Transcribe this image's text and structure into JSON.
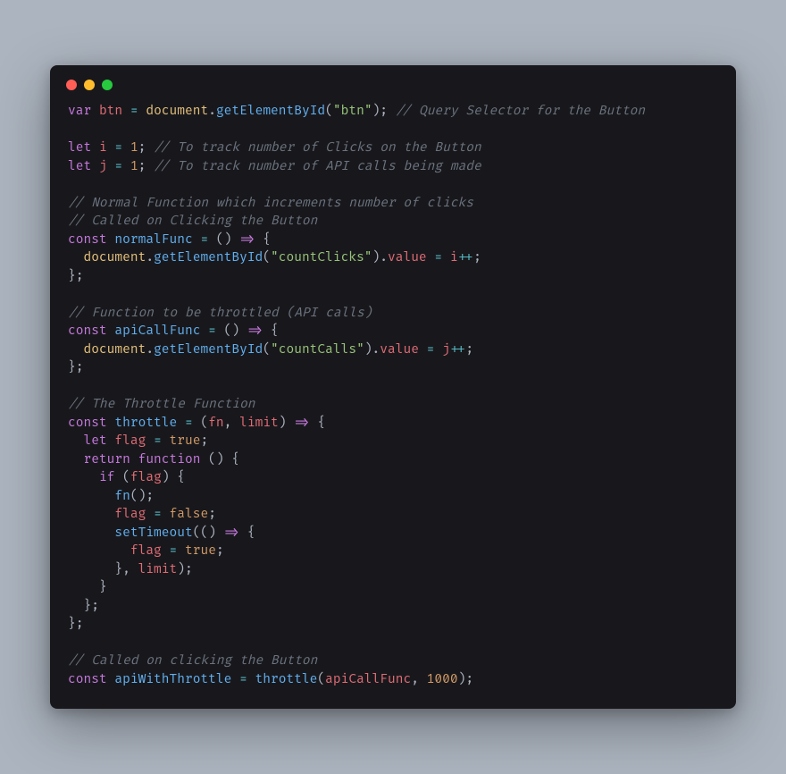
{
  "window": {
    "dots": [
      "close",
      "minimize",
      "zoom"
    ]
  },
  "code": {
    "lines": [
      [
        {
          "t": "var ",
          "c": "kw"
        },
        {
          "t": "btn",
          "c": "id"
        },
        {
          "t": " ",
          "c": "pn"
        },
        {
          "t": "=",
          "c": "op"
        },
        {
          "t": " ",
          "c": "pn"
        },
        {
          "t": "document",
          "c": "obj"
        },
        {
          "t": ".",
          "c": "pn"
        },
        {
          "t": "getElementById",
          "c": "fn"
        },
        {
          "t": "(",
          "c": "pn"
        },
        {
          "t": "\"btn\"",
          "c": "str"
        },
        {
          "t": "); ",
          "c": "pn"
        },
        {
          "t": "// Query Selector for the Button",
          "c": "cm"
        }
      ],
      [
        {
          "t": "",
          "c": "pn"
        }
      ],
      [
        {
          "t": "let ",
          "c": "kw"
        },
        {
          "t": "i",
          "c": "id"
        },
        {
          "t": " ",
          "c": "pn"
        },
        {
          "t": "=",
          "c": "op"
        },
        {
          "t": " ",
          "c": "pn"
        },
        {
          "t": "1",
          "c": "num"
        },
        {
          "t": "; ",
          "c": "pn"
        },
        {
          "t": "// To track number of Clicks on the Button",
          "c": "cm"
        }
      ],
      [
        {
          "t": "let ",
          "c": "kw"
        },
        {
          "t": "j",
          "c": "id"
        },
        {
          "t": " ",
          "c": "pn"
        },
        {
          "t": "=",
          "c": "op"
        },
        {
          "t": " ",
          "c": "pn"
        },
        {
          "t": "1",
          "c": "num"
        },
        {
          "t": "; ",
          "c": "pn"
        },
        {
          "t": "// To track number of API calls being made",
          "c": "cm"
        }
      ],
      [
        {
          "t": "",
          "c": "pn"
        }
      ],
      [
        {
          "t": "// Normal Function which increments number of clicks",
          "c": "cm"
        }
      ],
      [
        {
          "t": "// Called on Clicking the Button",
          "c": "cm"
        }
      ],
      [
        {
          "t": "const ",
          "c": "kw"
        },
        {
          "t": "normalFunc",
          "c": "fn"
        },
        {
          "t": " ",
          "c": "pn"
        },
        {
          "t": "=",
          "c": "op"
        },
        {
          "t": " () ",
          "c": "pn"
        },
        {
          "t": "=>",
          "c": "op2"
        },
        {
          "t": " {",
          "c": "pn"
        }
      ],
      [
        {
          "t": "  ",
          "c": "pn"
        },
        {
          "t": "document",
          "c": "obj"
        },
        {
          "t": ".",
          "c": "pn"
        },
        {
          "t": "getElementById",
          "c": "fn"
        },
        {
          "t": "(",
          "c": "pn"
        },
        {
          "t": "\"countClicks\"",
          "c": "str"
        },
        {
          "t": ").",
          "c": "pn"
        },
        {
          "t": "value",
          "c": "id"
        },
        {
          "t": " ",
          "c": "pn"
        },
        {
          "t": "=",
          "c": "op"
        },
        {
          "t": " ",
          "c": "pn"
        },
        {
          "t": "i",
          "c": "id"
        },
        {
          "t": "++",
          "c": "op"
        },
        {
          "t": ";",
          "c": "pn"
        }
      ],
      [
        {
          "t": "};",
          "c": "pn"
        }
      ],
      [
        {
          "t": "",
          "c": "pn"
        }
      ],
      [
        {
          "t": "// Function to be throttled (API calls)",
          "c": "cm"
        }
      ],
      [
        {
          "t": "const ",
          "c": "kw"
        },
        {
          "t": "apiCallFunc",
          "c": "fn"
        },
        {
          "t": " ",
          "c": "pn"
        },
        {
          "t": "=",
          "c": "op"
        },
        {
          "t": " () ",
          "c": "pn"
        },
        {
          "t": "=>",
          "c": "op2"
        },
        {
          "t": " {",
          "c": "pn"
        }
      ],
      [
        {
          "t": "  ",
          "c": "pn"
        },
        {
          "t": "document",
          "c": "obj"
        },
        {
          "t": ".",
          "c": "pn"
        },
        {
          "t": "getElementById",
          "c": "fn"
        },
        {
          "t": "(",
          "c": "pn"
        },
        {
          "t": "\"countCalls\"",
          "c": "str"
        },
        {
          "t": ").",
          "c": "pn"
        },
        {
          "t": "value",
          "c": "id"
        },
        {
          "t": " ",
          "c": "pn"
        },
        {
          "t": "=",
          "c": "op"
        },
        {
          "t": " ",
          "c": "pn"
        },
        {
          "t": "j",
          "c": "id"
        },
        {
          "t": "++",
          "c": "op"
        },
        {
          "t": ";",
          "c": "pn"
        }
      ],
      [
        {
          "t": "};",
          "c": "pn"
        }
      ],
      [
        {
          "t": "",
          "c": "pn"
        }
      ],
      [
        {
          "t": "// The Throttle Function",
          "c": "cm"
        }
      ],
      [
        {
          "t": "const ",
          "c": "kw"
        },
        {
          "t": "throttle",
          "c": "fn"
        },
        {
          "t": " ",
          "c": "pn"
        },
        {
          "t": "=",
          "c": "op"
        },
        {
          "t": " (",
          "c": "pn"
        },
        {
          "t": "fn",
          "c": "id"
        },
        {
          "t": ", ",
          "c": "pn"
        },
        {
          "t": "limit",
          "c": "id"
        },
        {
          "t": ") ",
          "c": "pn"
        },
        {
          "t": "=>",
          "c": "op2"
        },
        {
          "t": " {",
          "c": "pn"
        }
      ],
      [
        {
          "t": "  ",
          "c": "pn"
        },
        {
          "t": "let ",
          "c": "kw"
        },
        {
          "t": "flag",
          "c": "id"
        },
        {
          "t": " ",
          "c": "pn"
        },
        {
          "t": "=",
          "c": "op"
        },
        {
          "t": " ",
          "c": "pn"
        },
        {
          "t": "true",
          "c": "bool"
        },
        {
          "t": ";",
          "c": "pn"
        }
      ],
      [
        {
          "t": "  ",
          "c": "pn"
        },
        {
          "t": "return",
          "c": "kw"
        },
        {
          "t": " ",
          "c": "pn"
        },
        {
          "t": "function",
          "c": "kw"
        },
        {
          "t": " () {",
          "c": "pn"
        }
      ],
      [
        {
          "t": "    ",
          "c": "pn"
        },
        {
          "t": "if",
          "c": "kw"
        },
        {
          "t": " (",
          "c": "pn"
        },
        {
          "t": "flag",
          "c": "id"
        },
        {
          "t": ") {",
          "c": "pn"
        }
      ],
      [
        {
          "t": "      ",
          "c": "pn"
        },
        {
          "t": "fn",
          "c": "fn"
        },
        {
          "t": "();",
          "c": "pn"
        }
      ],
      [
        {
          "t": "      ",
          "c": "pn"
        },
        {
          "t": "flag",
          "c": "id"
        },
        {
          "t": " ",
          "c": "pn"
        },
        {
          "t": "=",
          "c": "op"
        },
        {
          "t": " ",
          "c": "pn"
        },
        {
          "t": "false",
          "c": "bool"
        },
        {
          "t": ";",
          "c": "pn"
        }
      ],
      [
        {
          "t": "      ",
          "c": "pn"
        },
        {
          "t": "setTimeout",
          "c": "fn"
        },
        {
          "t": "(() ",
          "c": "pn"
        },
        {
          "t": "=>",
          "c": "op2"
        },
        {
          "t": " {",
          "c": "pn"
        }
      ],
      [
        {
          "t": "        ",
          "c": "pn"
        },
        {
          "t": "flag",
          "c": "id"
        },
        {
          "t": " ",
          "c": "pn"
        },
        {
          "t": "=",
          "c": "op"
        },
        {
          "t": " ",
          "c": "pn"
        },
        {
          "t": "true",
          "c": "bool"
        },
        {
          "t": ";",
          "c": "pn"
        }
      ],
      [
        {
          "t": "      }, ",
          "c": "pn"
        },
        {
          "t": "limit",
          "c": "id"
        },
        {
          "t": ");",
          "c": "pn"
        }
      ],
      [
        {
          "t": "    }",
          "c": "pn"
        }
      ],
      [
        {
          "t": "  };",
          "c": "pn"
        }
      ],
      [
        {
          "t": "};",
          "c": "pn"
        }
      ],
      [
        {
          "t": "",
          "c": "pn"
        }
      ],
      [
        {
          "t": "// Called on clicking the Button",
          "c": "cm"
        }
      ],
      [
        {
          "t": "const ",
          "c": "kw"
        },
        {
          "t": "apiWithThrottle",
          "c": "fn"
        },
        {
          "t": " ",
          "c": "pn"
        },
        {
          "t": "=",
          "c": "op"
        },
        {
          "t": " ",
          "c": "pn"
        },
        {
          "t": "throttle",
          "c": "fn"
        },
        {
          "t": "(",
          "c": "pn"
        },
        {
          "t": "apiCallFunc",
          "c": "id"
        },
        {
          "t": ", ",
          "c": "pn"
        },
        {
          "t": "1000",
          "c": "num"
        },
        {
          "t": ");",
          "c": "pn"
        }
      ]
    ]
  }
}
